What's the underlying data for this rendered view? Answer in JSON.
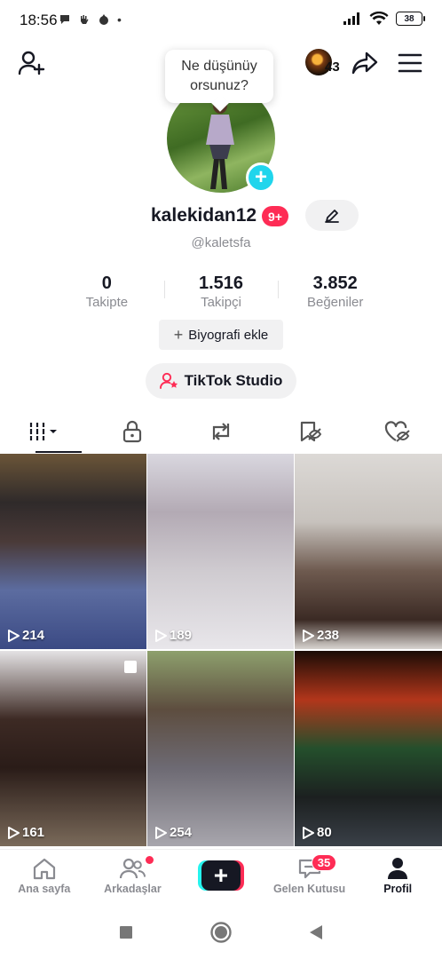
{
  "status_bar": {
    "time": "18:56",
    "battery": "38"
  },
  "header": {
    "tooltip": "Ne düşünüy orsunuz?",
    "viewers_count": "43"
  },
  "profile": {
    "username": "kalekidan12",
    "badge": "9+",
    "handle": "@kaletsfa",
    "stats": [
      {
        "value": "0",
        "label": "Takipte"
      },
      {
        "value": "1.516",
        "label": "Takipçi"
      },
      {
        "value": "3.852",
        "label": "Beğeniler"
      }
    ],
    "bio_button": "Biyografi ekle",
    "studio_button": "TikTok Studio"
  },
  "videos": [
    {
      "views": "214"
    },
    {
      "views": "189"
    },
    {
      "views": "238"
    },
    {
      "views": "161"
    },
    {
      "views": "254"
    },
    {
      "views": "80"
    }
  ],
  "bottom_nav": {
    "home": "Ana sayfa",
    "friends": "Arkadaşlar",
    "inbox": "Gelen Kutusu",
    "inbox_badge": "35",
    "profile": "Profil"
  },
  "colors": {
    "accent": "#fe2c55",
    "cyan": "#25f4ee",
    "plus": "#20d5ec"
  }
}
